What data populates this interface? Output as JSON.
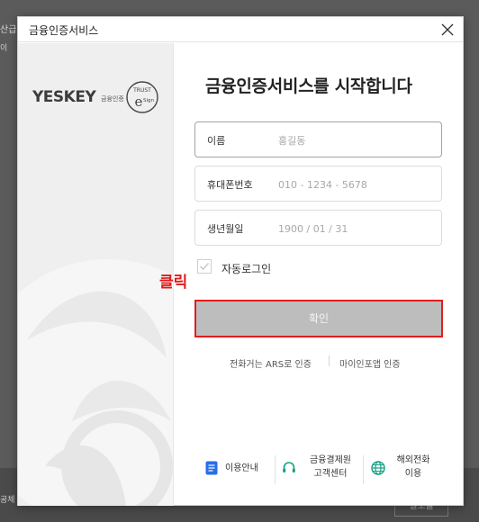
{
  "background": {
    "text_top_1": "산급",
    "text_top_2": "이",
    "text_bottom": "공체",
    "button": "결모블"
  },
  "modal": {
    "title": "금융인증서비스",
    "close_icon": "close-icon",
    "logo": {
      "wordmark": "YESKEY",
      "subtitle": "금융인증",
      "badge_top": "TRUST",
      "badge_letter": "e",
      "badge_side": "Sign"
    },
    "headline": "금융인증서비스를 시작합니다",
    "fields": [
      {
        "label": "이름",
        "placeholder": "홍길동"
      },
      {
        "label": "휴대폰번호",
        "placeholder": "010 - 1234 - 5678"
      },
      {
        "label": "생년월일",
        "placeholder": "1900 / 01 / 31"
      }
    ],
    "auto_login": {
      "label": "자동로그인",
      "checked": false
    },
    "click_hint": "클릭",
    "confirm_button": "확인",
    "alt_auth": {
      "phone_ars": "전화거는 ARS로 인증",
      "mydata": "마이인포앱 인증"
    },
    "footer": [
      {
        "icon": "document-icon",
        "label": "이용안내",
        "color": "#2a6ee8"
      },
      {
        "icon": "headset-icon",
        "label_line1": "금융결제원",
        "label_line2": "고객센터",
        "color": "#16a085"
      },
      {
        "icon": "globe-icon",
        "label_line1": "해외전화",
        "label_line2": "이용",
        "color": "#16a085"
      }
    ],
    "colors": {
      "accent_red": "#e21e1e",
      "button_gray": "#bdbdbd"
    }
  }
}
